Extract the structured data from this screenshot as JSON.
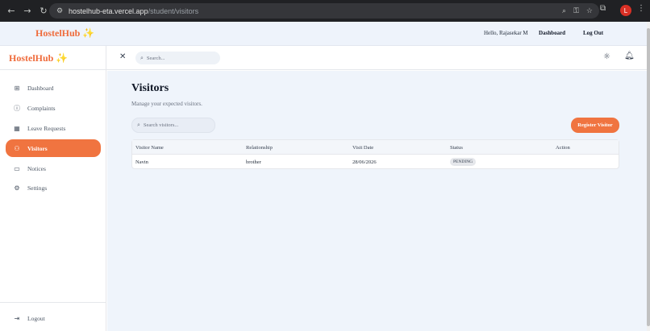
{
  "browser": {
    "url_host": "hostelhub-eta.vercel.app",
    "url_path": "/student/visitors",
    "profile_initial": "L"
  },
  "topnav": {
    "brand": "HostelHub ✨",
    "greeting": "Hello, Rajasekar M",
    "dashboard_link": "Dashboard",
    "logout_link": "Log Out"
  },
  "sidebar": {
    "brand": "HostelHub ✨",
    "items": [
      {
        "label": "Dashboard",
        "icon": "grid-icon",
        "active": false
      },
      {
        "label": "Complaints",
        "icon": "alert-circle-icon",
        "active": false
      },
      {
        "label": "Leave Requests",
        "icon": "calendar-icon",
        "active": false
      },
      {
        "label": "Visitors",
        "icon": "user-check-icon",
        "active": true
      },
      {
        "label": "Notices",
        "icon": "message-square-icon",
        "active": false
      },
      {
        "label": "Settings",
        "icon": "gear-icon",
        "active": false
      }
    ],
    "logout": "Logout"
  },
  "header": {
    "search_placeholder": "Search..."
  },
  "page": {
    "title": "Visitors",
    "subtitle": "Manage your expected visitors.",
    "search_placeholder": "Search visitors...",
    "register_button": "Register Visitor"
  },
  "table": {
    "columns": [
      "Visitor Name",
      "Relationship",
      "Visit Date",
      "Status",
      "Action"
    ],
    "rows": [
      {
        "name": "Navin",
        "relationship": "brother",
        "date": "28/06/2026",
        "status": "PENDING",
        "action": ""
      }
    ]
  },
  "colors": {
    "accent": "#f07440",
    "brand": "#ef6b3b",
    "background": "#eff4fb"
  }
}
